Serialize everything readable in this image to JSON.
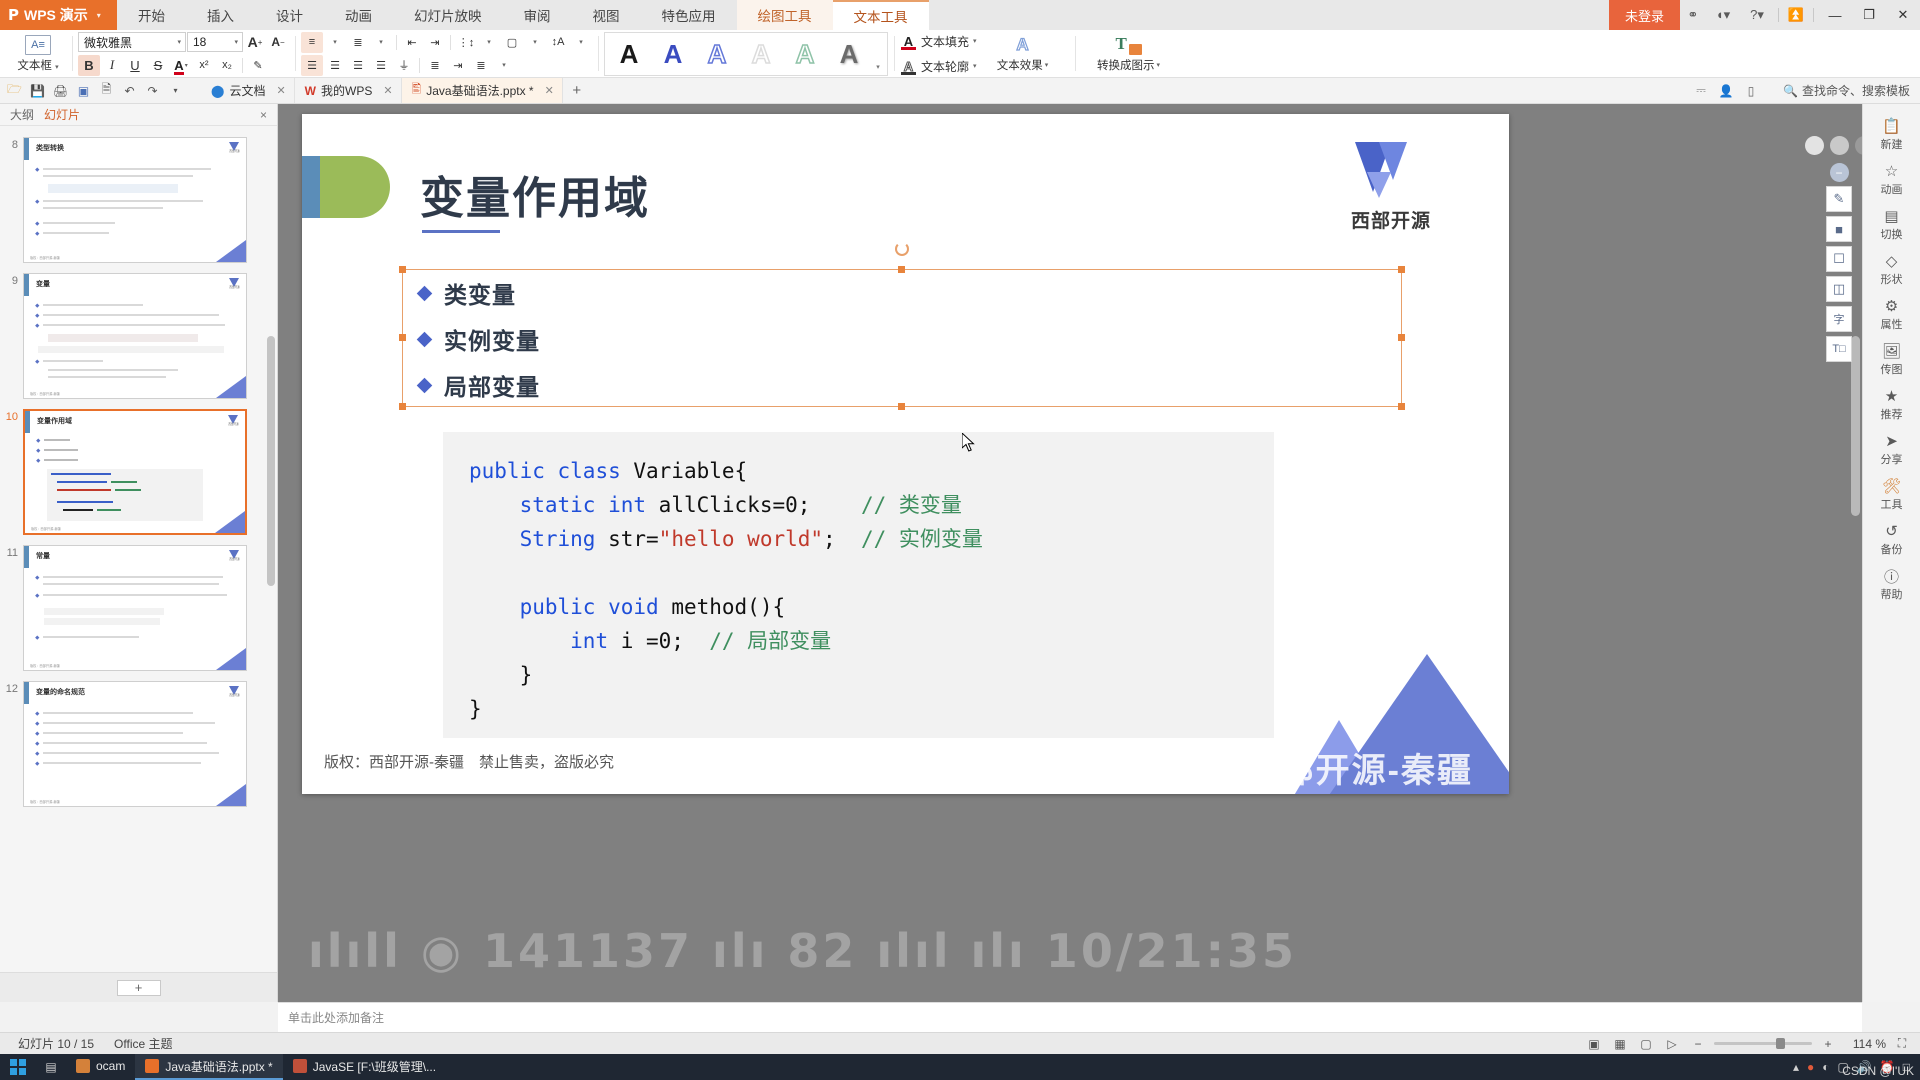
{
  "app": {
    "brand": "WPS 演示",
    "login_status": "未登录"
  },
  "menu": {
    "tabs": [
      {
        "label": "开始",
        "state": "normal"
      },
      {
        "label": "插入",
        "state": "normal"
      },
      {
        "label": "设计",
        "state": "normal"
      },
      {
        "label": "动画",
        "state": "normal"
      },
      {
        "label": "幻灯片放映",
        "state": "normal"
      },
      {
        "label": "审阅",
        "state": "normal"
      },
      {
        "label": "视图",
        "state": "normal"
      },
      {
        "label": "特色应用",
        "state": "normal"
      },
      {
        "label": "绘图工具",
        "state": "context"
      },
      {
        "label": "文本工具",
        "state": "context-active"
      }
    ]
  },
  "titlebar_right": {
    "icons": [
      "shield-icon",
      "wps-cloud-icon",
      "help-icon",
      "upload-icon"
    ],
    "window": [
      "minimize",
      "restore",
      "close"
    ]
  },
  "ribbon": {
    "textbox_label": "文本框",
    "font_name": "微软雅黑",
    "font_size": "18",
    "grow_font": "A",
    "shrink_font": "A",
    "bold": "B",
    "italic": "I",
    "underline": "U",
    "strikethrough": "S",
    "font_color": "A",
    "superscript": "x²",
    "subscript": "x₂",
    "clear_format": "clear-format-icon",
    "wordart_styles": [
      "A",
      "A",
      "A",
      "A",
      "A",
      "A"
    ],
    "text_fill": "文本填充",
    "text_outline": "文本轮廓",
    "text_effects": "文本效果",
    "convert_to_smartart": "转换成图示"
  },
  "doctabs": {
    "tabs": [
      {
        "label": "云文档",
        "icon": "cloud-doc-icon",
        "active": false
      },
      {
        "label": "我的WPS",
        "icon": "wps-icon",
        "active": false
      },
      {
        "label": "Java基础语法.pptx *",
        "icon": "pptx-icon",
        "active": true
      }
    ],
    "new_tab": "+",
    "search_label": "查找命令、搜索模板"
  },
  "left_panel": {
    "tab_outline": "大纲",
    "tab_slides": "幻灯片",
    "close": "×",
    "add_slide": "+",
    "slides": [
      {
        "num": "8",
        "title": "类型转换",
        "selected": false
      },
      {
        "num": "9",
        "title": "变量",
        "selected": false
      },
      {
        "num": "10",
        "title": "变量作用域",
        "selected": true
      },
      {
        "num": "11",
        "title": "常量",
        "selected": false
      },
      {
        "num": "12",
        "title": "变量的命名规范",
        "selected": false
      }
    ]
  },
  "slide": {
    "title": "变量作用域",
    "logo_text": "西部开源",
    "bullets": [
      "类变量",
      "实例变量",
      "局部变量"
    ],
    "code_lines": [
      [
        {
          "t": "public ",
          "c": "k"
        },
        {
          "t": "class ",
          "c": "k"
        },
        {
          "t": "Variable",
          "c": "id"
        },
        {
          "t": "{",
          "c": "id"
        }
      ],
      [
        {
          "t": "    ",
          "c": "id"
        },
        {
          "t": "static ",
          "c": "k"
        },
        {
          "t": "int ",
          "c": "k"
        },
        {
          "t": "allClicks=0;",
          "c": "id"
        },
        {
          "t": "    ",
          "c": "id"
        },
        {
          "t": "// 类变量",
          "c": "cm"
        }
      ],
      [
        {
          "t": "    ",
          "c": "id"
        },
        {
          "t": "String ",
          "c": "k"
        },
        {
          "t": "str=",
          "c": "id"
        },
        {
          "t": "\"hello world\"",
          "c": "str"
        },
        {
          "t": ";  ",
          "c": "id"
        },
        {
          "t": "// 实例变量",
          "c": "cm"
        }
      ],
      [],
      [
        {
          "t": "    ",
          "c": "id"
        },
        {
          "t": "public ",
          "c": "k"
        },
        {
          "t": "void ",
          "c": "k"
        },
        {
          "t": "method",
          "c": "id"
        },
        {
          "t": "(){",
          "c": "id"
        }
      ],
      [
        {
          "t": "        ",
          "c": "id"
        },
        {
          "t": "int ",
          "c": "k"
        },
        {
          "t": "i =0;  ",
          "c": "id"
        },
        {
          "t": "// 局部变量",
          "c": "cm"
        }
      ],
      [
        {
          "t": "    }",
          "c": "id"
        }
      ],
      [
        {
          "t": "}",
          "c": "id"
        }
      ]
    ],
    "copyright": "版权：西部开源-秦疆　禁止售卖，盗版必究",
    "watermark": "西部开源-秦疆"
  },
  "right_tools": {
    "items": [
      {
        "icon": "new-icon",
        "label": "新建"
      },
      {
        "icon": "animation-icon",
        "label": "动画"
      },
      {
        "icon": "transition-icon",
        "label": "切换"
      },
      {
        "icon": "shape-icon",
        "label": "形状"
      },
      {
        "icon": "properties-icon",
        "label": "属性"
      },
      {
        "icon": "media-icon",
        "label": "传图"
      },
      {
        "icon": "recommend-icon",
        "label": "推荐"
      },
      {
        "icon": "share-icon",
        "label": "分享"
      },
      {
        "icon": "tools-icon",
        "label": "工具"
      },
      {
        "icon": "backup-icon",
        "label": "备份"
      },
      {
        "icon": "help-icon",
        "label": "帮助"
      }
    ]
  },
  "float_tools": {
    "buttons": [
      "edit-shape-icon",
      "eraser-icon",
      "crop-icon",
      "layers-icon",
      "word-icon",
      "smartart-icon"
    ]
  },
  "notes": {
    "placeholder": "单击此处添加备注"
  },
  "statusbar": {
    "slide_counter": "幻灯片 10 / 15",
    "theme": "Office 主题",
    "zoom": "114 %",
    "zoom_out": "−",
    "zoom_in": "+",
    "view_icons": [
      "normal-view-icon",
      "sorter-view-icon",
      "reading-view-icon",
      "slideshow-icon"
    ]
  },
  "taskbar": {
    "items": [
      {
        "label": "ocam",
        "color": "#d4813a",
        "running": false
      },
      {
        "label": "Java基础语法.pptx *",
        "color": "#e8702a",
        "running": true
      },
      {
        "label": "JavaSE [F:\\班级管理\\...",
        "color": "#c0503a",
        "running": false
      }
    ],
    "tray": [
      "chevron-up-icon",
      "record-icon",
      "network-icon",
      "ime-icon",
      "volume-icon",
      "clock-icon"
    ],
    "watermark": "CSDN @I'UK"
  }
}
